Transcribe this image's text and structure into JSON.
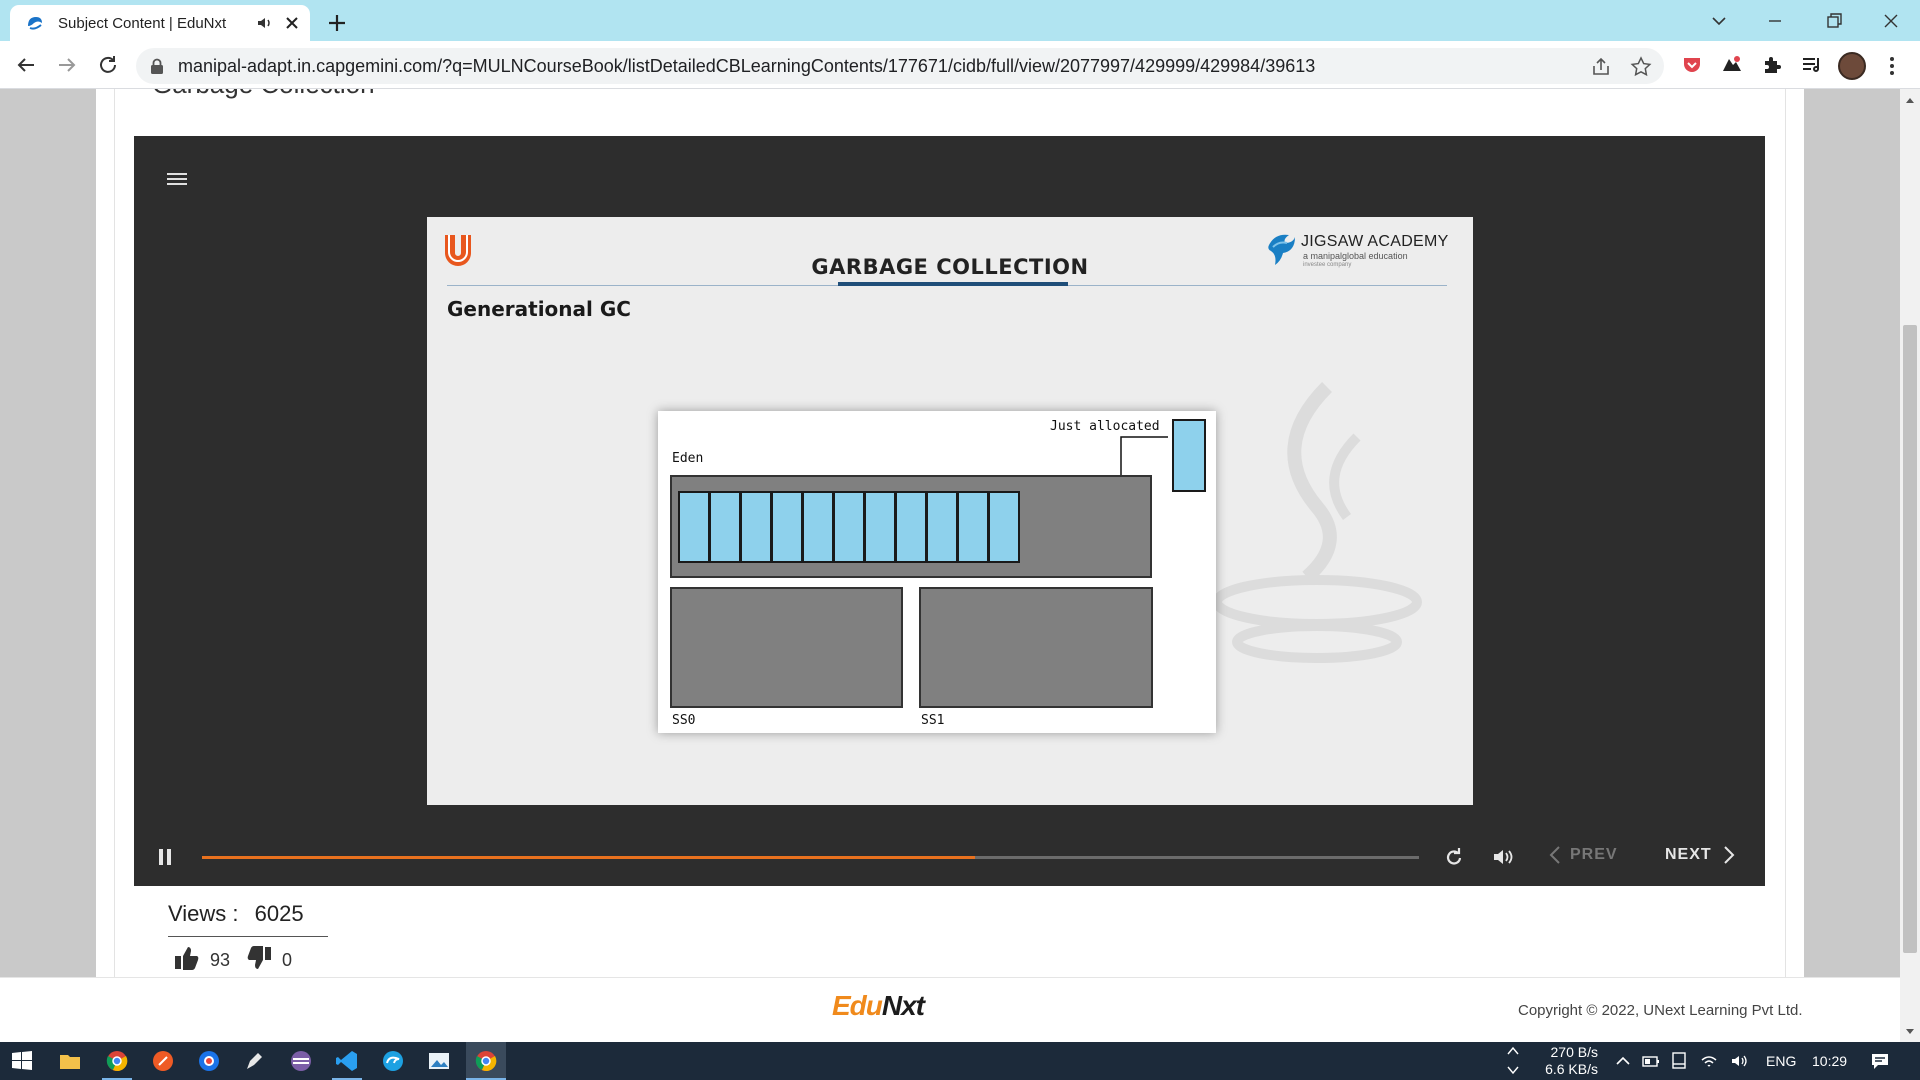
{
  "browser": {
    "tab_title": "Subject Content | EduNxt",
    "url": "manipal-adapt.in.capgemini.com/?q=MULNCourseBook/listDetailedCBLearningContents/177671/cidb/full/view/2077997/429999/429984/39613"
  },
  "page": {
    "section_title": "Garbage Collection"
  },
  "slide": {
    "title": "GARBAGE COLLECTION",
    "subheading": "Generational GC",
    "brand_name": "JIGSAW ACADEMY",
    "brand_sub": "a manipalglobal education",
    "brand_sub2": "investee company",
    "diagram": {
      "just_allocated_label": "Just allocated",
      "eden_label": "Eden",
      "ss0_label": "SS0",
      "ss1_label": "SS1",
      "eden_cell_count": 11
    }
  },
  "player": {
    "progress_fraction": 0.635,
    "prev_label": "PREV",
    "next_label": "NEXT"
  },
  "stats": {
    "views_label": "Views :",
    "views_value": "6025",
    "likes": "93",
    "dislikes": "0"
  },
  "footer": {
    "logo_edu": "Edu",
    "logo_nxt": "Nxt",
    "copyright": "Copyright © 2022, UNext Learning Pvt Ltd."
  },
  "taskbar": {
    "net_up": "270 B/s",
    "net_down": "6.6 KB/s",
    "language": "ENG",
    "time": "10:29"
  },
  "colors": {
    "progress": "#e8711e",
    "cell_blue": "#8ed1ec",
    "tab_strip": "#b1e4f1"
  }
}
